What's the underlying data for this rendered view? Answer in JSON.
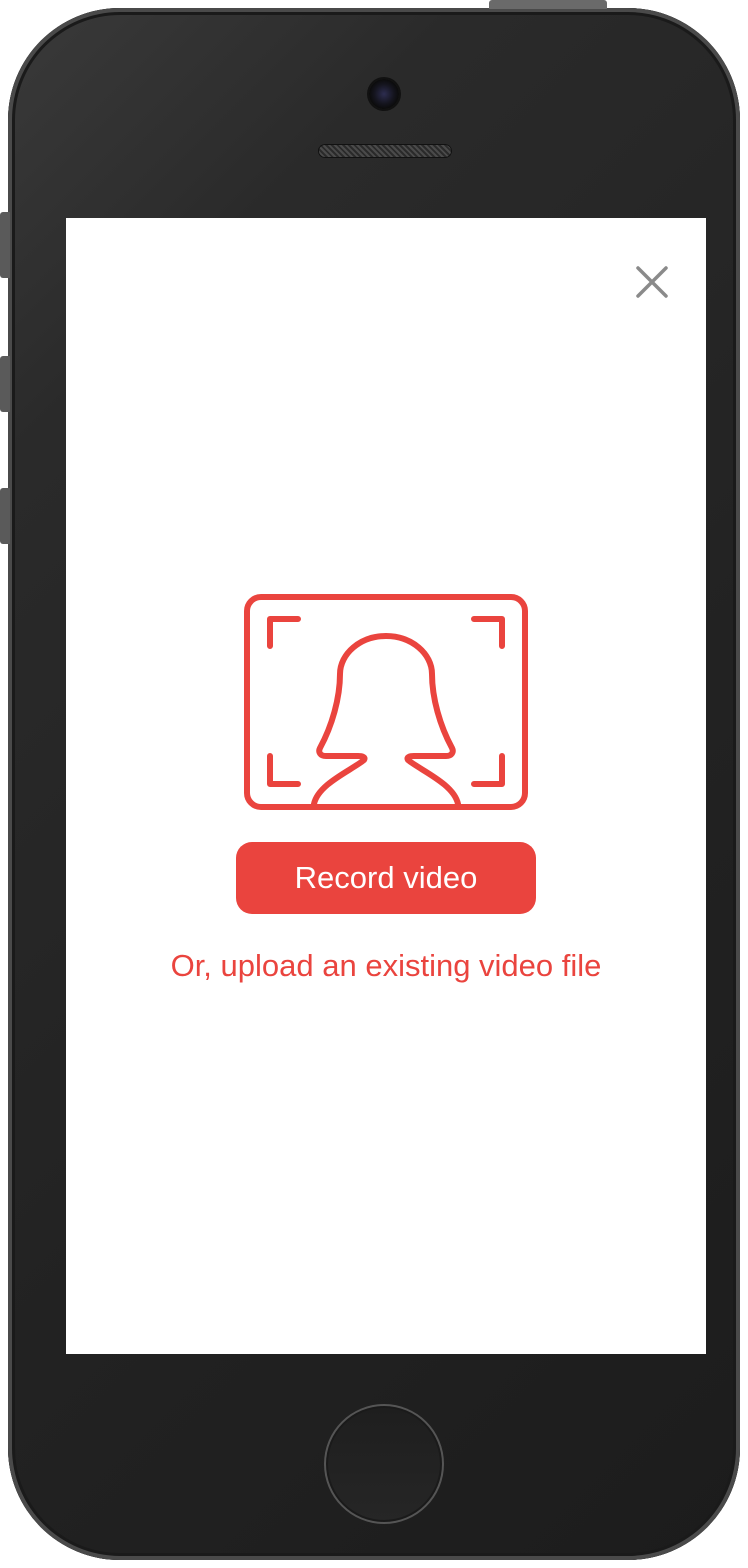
{
  "device": {
    "frame_color": "#222222",
    "screen_color": "#ffffff"
  },
  "modal": {
    "close_icon": "close-icon",
    "illustration_icon": "video-portrait-frame-icon",
    "accent_color": "#ea443e",
    "record_button_label": "Record video",
    "upload_link_text": "Or, upload an existing video file"
  }
}
